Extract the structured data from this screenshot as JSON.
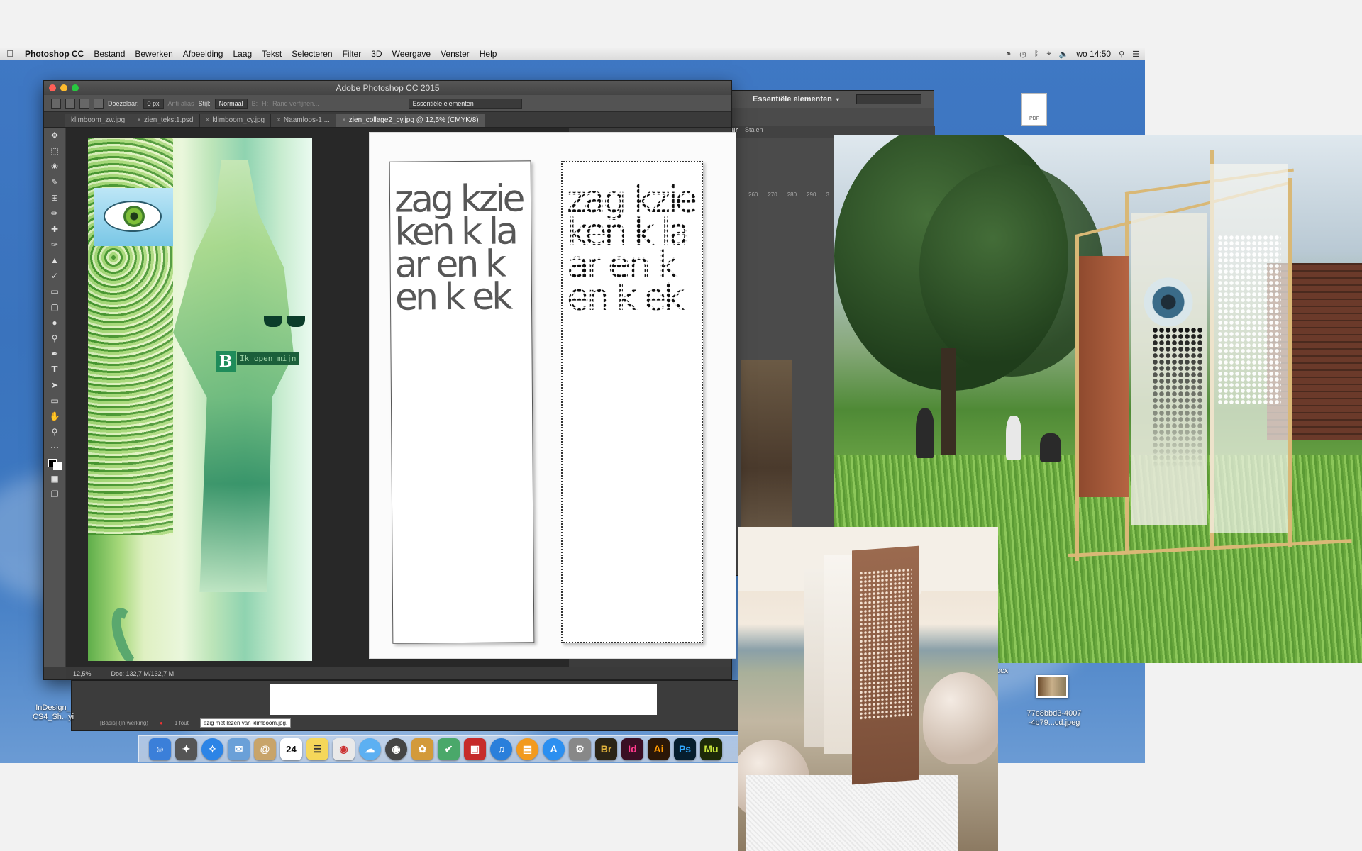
{
  "menubar": {
    "app": "Photoshop CC",
    "items": [
      "Bestand",
      "Bewerken",
      "Afbeelding",
      "Laag",
      "Tekst",
      "Selecteren",
      "Filter",
      "3D",
      "Weergave",
      "Venster",
      "Help"
    ],
    "clock": "wo 14:50"
  },
  "photoshop": {
    "window_title": "Adobe Photoshop CC 2015",
    "options": {
      "feather_label": "Doezelaar:",
      "feather_value": "0 px",
      "antialias": "Anti-alias",
      "style_label": "Stijl:",
      "style_value": "Normaal",
      "width_label": "B:",
      "height_label": "H:",
      "refine_edge": "Rand verfijnen...",
      "workspace": "Essentiële elementen"
    },
    "tabs": [
      "klimboom_zw.jpg",
      "zien_tekst1.psd",
      "klimboom_cy.jpg",
      "Naamloos-1 ...",
      "zien_collage2_cy.jpg @ 12,5% (CMYK/8)"
    ],
    "status": {
      "zoom": "12,5%",
      "doc": "Doc: 132,7 M/132,7 M"
    },
    "collage_label": "Ik open mijn"
  },
  "panel": {
    "workspace": "Essentiële elementen",
    "tabs": [
      "Kleur",
      "Stalen"
    ],
    "ruler": [
      "260",
      "270",
      "280",
      "290",
      "3"
    ]
  },
  "secondary": {
    "status_left": "[Basis] (In werking)",
    "error": "1 fout",
    "field": "ezig met lezen van klimboom.jpg."
  },
  "document": {
    "strip_text": "zag kzie ken k laar en k en k ek"
  },
  "desktop": {
    "pdf_label": "PDF",
    "indesign_label_1": "InDesign_",
    "indesign_label_2": "CS4_Sh...yi",
    "docx_suffix": "ocx",
    "image_label_1": "77e8bbd3-4007",
    "image_label_2": "-4b79...cd.jpeg"
  },
  "dock": {
    "apps": [
      {
        "label": "Br",
        "color": "#2b2516",
        "text": "#e0b33c"
      },
      {
        "label": "Id",
        "color": "#3a0f24",
        "text": "#ff3a8c"
      },
      {
        "label": "Ai",
        "color": "#2b1707",
        "text": "#ff9a00"
      },
      {
        "label": "Ps",
        "color": "#061e2e",
        "text": "#31a8ff"
      },
      {
        "label": "Mu",
        "color": "#1d2a08",
        "text": "#c6e33a"
      }
    ],
    "calendar_day": "24"
  }
}
